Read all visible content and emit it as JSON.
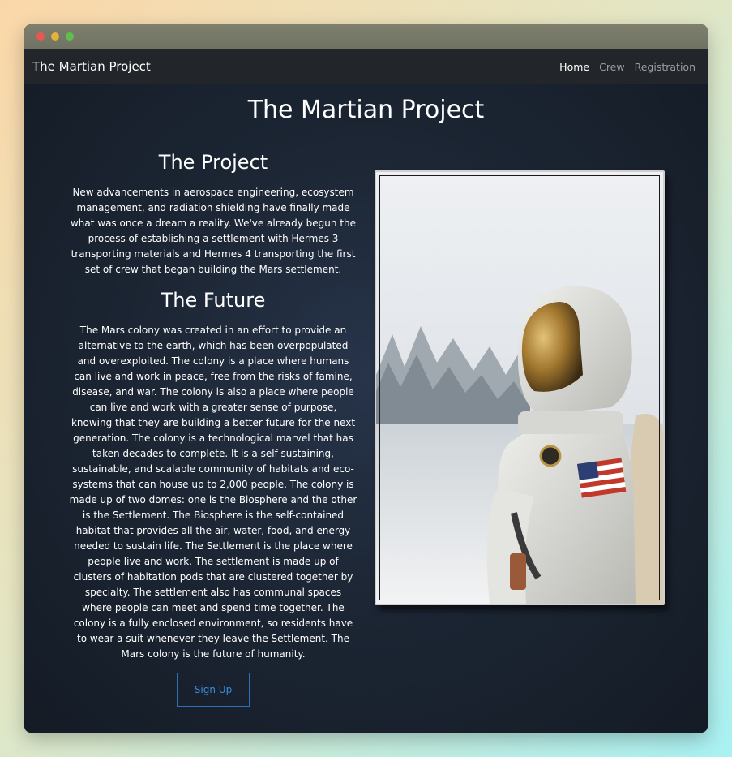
{
  "window": {
    "dots": [
      "#e8584f",
      "#e3b23c",
      "#5dc04a"
    ]
  },
  "navbar": {
    "brand": "The Martian Project",
    "links": [
      "Home",
      "Crew",
      "Registration"
    ]
  },
  "main": {
    "title": "The Martian Project",
    "project_title": "The Project",
    "project_text": "New advancements in aerospace engineering, ecosystem management, and radiation shielding have finally made what was once a dream a reality. We've already begun the process of establishing a settlement with Hermes 3 transporting materials and Hermes 4 transporting the first set of crew that began building the Mars settlement.",
    "future_title": "The Future",
    "future_text": "The Mars colony was created in an effort to provide an alternative to the earth, which has been overpopulated and overexploited. The colony is a place where humans can live and work in peace, free from the risks of famine, disease, and war. The colony is also a place where people can live and work with a greater sense of purpose, knowing that they are building a better future for the next generation. The colony is a technological marvel that has taken decades to complete. It is a self-sustaining, sustainable, and scalable community of habitats and eco-systems that can house up to 2,000 people. The colony is made up of two domes: one is the Biosphere and the other is the Settlement. The Biosphere is the self-contained habitat that provides all the air, water, food, and energy needed to sustain life. The Settlement is the place where people live and work. The settlement is made up of clusters of habitation pods that are clustered together by specialty. The settlement also has communal spaces where people can meet and spend time together. The colony is a fully enclosed environment, so residents have to wear a suit whenever they leave the Settlement. The Mars colony is the future of humanity.",
    "signup_label": "Sign Up"
  },
  "colors": {
    "accent": "#2d6fb8",
    "navbar_bg": "#222529"
  },
  "image": {
    "subject": "astronaut-photo"
  }
}
